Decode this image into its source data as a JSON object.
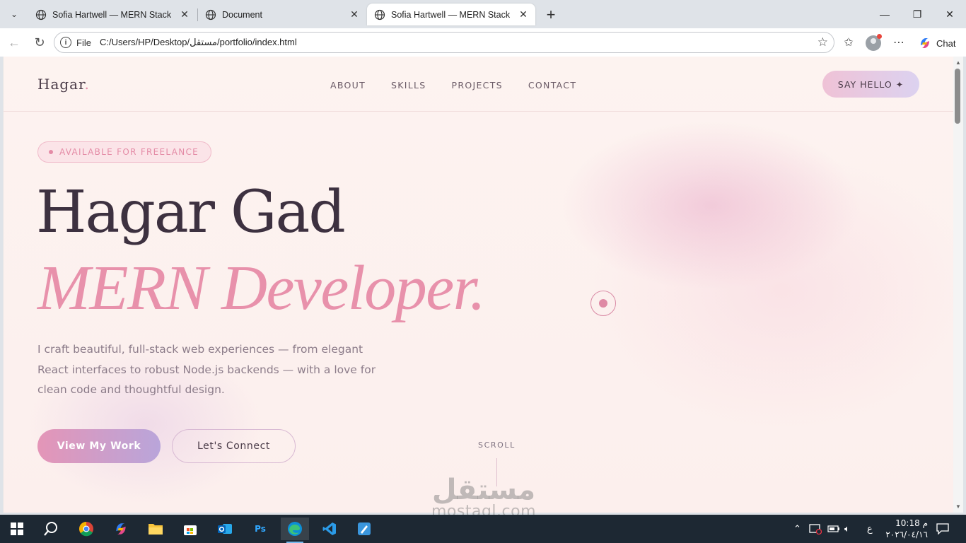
{
  "browser": {
    "tabs": [
      {
        "title": "Sofia Hartwell — MERN Stack Deve",
        "active": false
      },
      {
        "title": "Document",
        "active": false
      },
      {
        "title": "Sofia Hartwell — MERN Stack Deve",
        "active": true
      }
    ],
    "address": {
      "scheme_label": "File",
      "url": "C:/Users/HP/Desktop/مستقل/portfolio/index.html"
    },
    "chat_label": "Chat"
  },
  "site": {
    "logo": "Hagar",
    "logo_dot": ".",
    "nav": [
      "ABOUT",
      "SKILLS",
      "PROJECTS",
      "CONTACT"
    ],
    "cta": "SAY HELLO ✦",
    "badge": "AVAILABLE FOR FREELANCE",
    "name": "Hagar Gad",
    "role": "MERN Developer.",
    "description": "I craft beautiful, full-stack web experiences — from elegant React interfaces to robust Node.js backends — with a love for clean code and thoughtful design.",
    "primary_button": "View My Work",
    "secondary_button": "Let's Connect",
    "scroll_label": "SCROLL"
  },
  "watermark": {
    "arabic": "مستقل",
    "latin": "mostaql.com"
  },
  "taskbar": {
    "lang": "ع",
    "time": "10:18 م",
    "date": "٢٠٢٦/٠٤/١٦"
  },
  "colors": {
    "accent_pink": "#e891ab",
    "heading": "#3d3140",
    "body_text": "#8c7c8a",
    "page_bg": "#fdf1ef"
  }
}
